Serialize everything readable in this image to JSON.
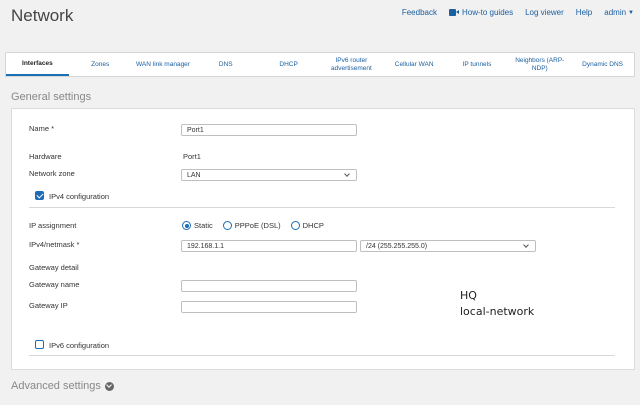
{
  "header": {
    "title": "Network",
    "links": {
      "feedback": "Feedback",
      "howto": "How-to guides",
      "logviewer": "Log viewer",
      "help": "Help",
      "user": "admin"
    }
  },
  "tabs": [
    {
      "label": "Interfaces"
    },
    {
      "label": "Zones"
    },
    {
      "label": "WAN link manager"
    },
    {
      "label": "DNS"
    },
    {
      "label": "DHCP"
    },
    {
      "label": "IPv6 router advertisement"
    },
    {
      "label": "Cellular WAN"
    },
    {
      "label": "IP tunnels"
    },
    {
      "label": "Neighbors (ARP-NDP)"
    },
    {
      "label": "Dynamic DNS"
    }
  ],
  "general": {
    "heading": "General settings",
    "name_label": "Name *",
    "name_value": "Port1",
    "hardware_label": "Hardware",
    "hardware_value": "Port1",
    "zone_label": "Network zone",
    "zone_value": "LAN",
    "ipv4_config_label": "IPv4 configuration",
    "ip_assignment_label": "IP assignment",
    "ip_options": [
      "Static",
      "PPPoE (DSL)",
      "DHCP"
    ],
    "ipv4_label": "IPv4/netmask *",
    "ipv4_value": "192.168.1.1",
    "netmask_value": "/24 (255.255.255.0)",
    "gateway_detail_label": "Gateway detail",
    "gateway_name_label": "Gateway name",
    "gateway_name_value": "",
    "gateway_ip_label": "Gateway IP",
    "gateway_ip_value": "",
    "ipv6_config_label": "IPv6 configuration"
  },
  "note": {
    "line1": "HQ",
    "line2": "local-network"
  },
  "advanced": {
    "heading": "Advanced settings"
  },
  "colors": {
    "accent": "#1e6cb6",
    "link": "#1a5fa0"
  }
}
